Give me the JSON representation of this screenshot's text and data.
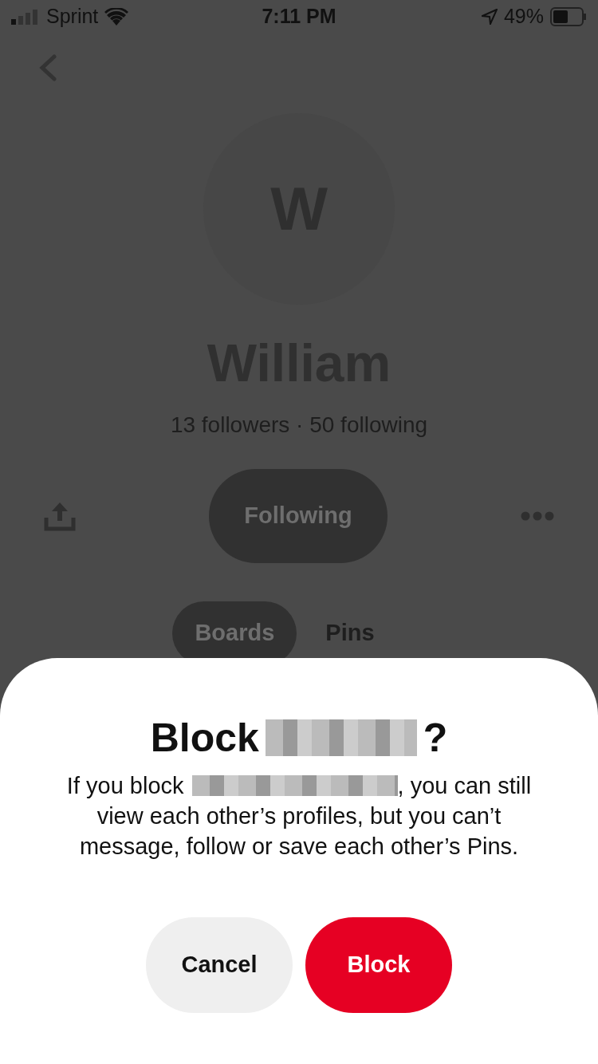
{
  "status_bar": {
    "carrier": "Sprint",
    "time": "7:11 PM",
    "battery": "49%"
  },
  "profile": {
    "initial": "W",
    "name": "William",
    "stats": "13 followers · 50 following",
    "follow_button": "Following"
  },
  "tabs": [
    {
      "label": "Boards",
      "selected": true
    },
    {
      "label": "Pins",
      "selected": false
    }
  ],
  "dialog": {
    "title_start": "Block",
    "title_end": "?",
    "message_start": "If you block",
    "message_after_name": ", you can still",
    "message_rest": "view each other’s profiles, but you can’t message, follow or save each other’s Pins.",
    "buttons": [
      {
        "label": "Cancel",
        "kind": "secondary"
      },
      {
        "label": "Block",
        "kind": "primary"
      }
    ]
  }
}
